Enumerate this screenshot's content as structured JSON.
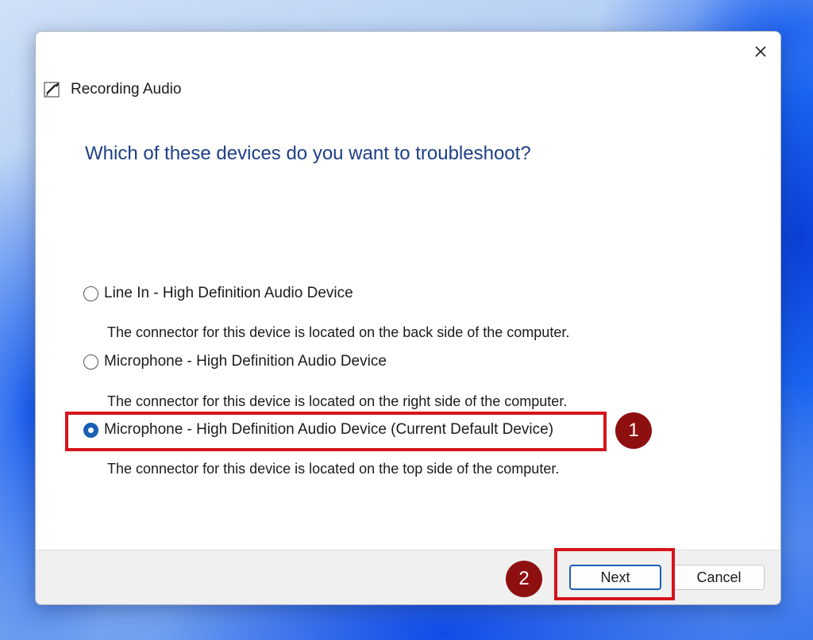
{
  "dialog": {
    "title": "Recording Audio",
    "heading": "Which of these devices do you want to troubleshoot?",
    "close_icon": "close-icon",
    "app_icon": "pen-paper-icon"
  },
  "options": [
    {
      "label": "Line In - High Definition Audio Device",
      "description": "The connector for this device is located on the back side of the computer.",
      "selected": false
    },
    {
      "label": "Microphone - High Definition Audio Device",
      "description": "The connector for this device is located on the right side of the computer.",
      "selected": false
    },
    {
      "label": "Microphone - High Definition Audio Device (Current Default Device)",
      "description": "The connector for this device is located on the top side of the computer.",
      "selected": true
    }
  ],
  "buttons": {
    "next": "Next",
    "cancel": "Cancel"
  },
  "annotations": {
    "step1": "1",
    "step2": "2",
    "highlight_color": "#d6141b",
    "marker_color": "#8e0f0f"
  },
  "colors": {
    "heading": "#1e3f87",
    "accent": "#1a5fb4"
  }
}
